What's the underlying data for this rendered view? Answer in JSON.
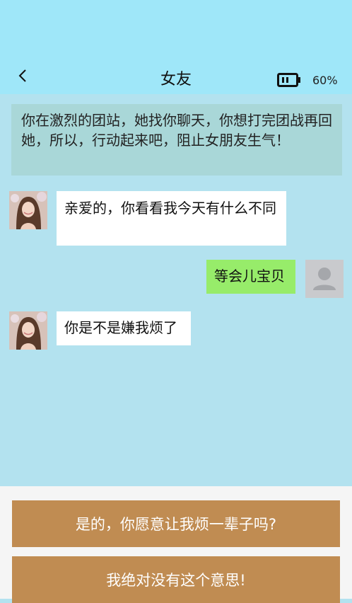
{
  "header": {
    "title": "女友",
    "battery_text": "60%",
    "battery_level": 0.6
  },
  "notice": {
    "text": "你在激烈的团站，她找你聊天，你想打完团战再回她，所以，行动起来吧，阻止女朋友生气！"
  },
  "messages": [
    {
      "from": "girlfriend",
      "text": "亲爱的，你看看我今天有什么不同"
    },
    {
      "from": "me",
      "text": "等会儿宝贝"
    },
    {
      "from": "girlfriend",
      "text": "你是不是嫌我烦了"
    }
  ],
  "choices": [
    {
      "label": "是的，你愿意让我烦一辈子吗?"
    },
    {
      "label": "我绝对没有这个意思!"
    }
  ],
  "colors": {
    "header_bg": "#9fe7f9",
    "chat_bg": "#b3e2ef",
    "notice_bg": "#a9d7d8",
    "my_bubble": "#97ec6a",
    "choice_bg": "#c08c52"
  }
}
